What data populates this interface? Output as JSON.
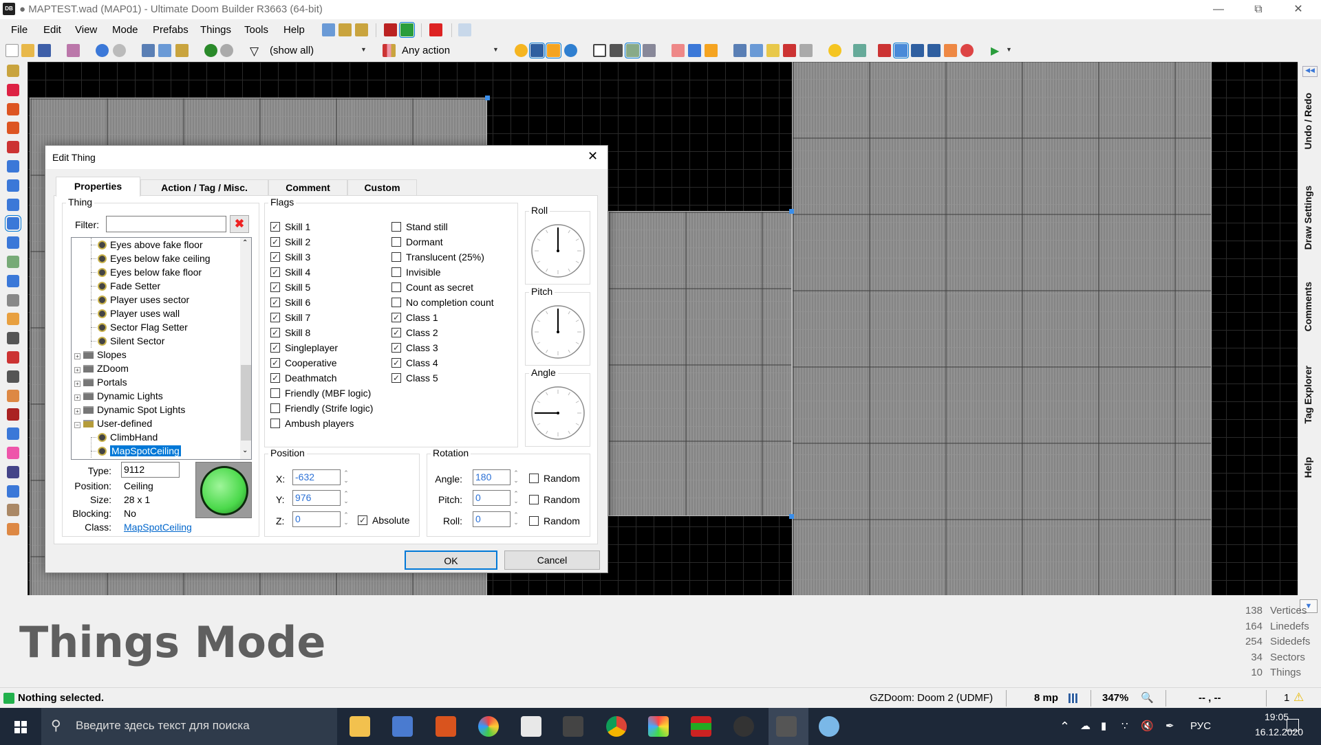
{
  "window": {
    "title": "● MAPTEST.wad (MAP01) - Ultimate Doom Builder R3663 (64-bit)",
    "logo": "DB"
  },
  "menu": [
    "File",
    "Edit",
    "View",
    "Mode",
    "Prefabs",
    "Things",
    "Tools",
    "Help"
  ],
  "toolbar": {
    "filter_value": "(show all)",
    "action_value": "Any action"
  },
  "side_tabs": [
    "Undo / Redo",
    "Draw Settings",
    "Comments",
    "Tag Explorer",
    "Help"
  ],
  "mode_title": "Things Mode",
  "stats": [
    {
      "count": "138",
      "label": "Vertices"
    },
    {
      "count": "164",
      "label": "Linedefs"
    },
    {
      "count": "254",
      "label": "Sidedefs"
    },
    {
      "count": "34",
      "label": "Sectors"
    },
    {
      "count": "10",
      "label": "Things"
    }
  ],
  "statusbar": {
    "message": "Nothing selected.",
    "game_config": "GZDoom: Doom 2 (UDMF)",
    "grid": "8 mp",
    "zoom": "347%",
    "coords": "-- , --",
    "warnings": "1",
    "status_color": "#22b14c"
  },
  "taskbar": {
    "search_placeholder": "Введите здесь текст для поиска",
    "language": "РУС",
    "time": "19:05",
    "date": "16.12.2020"
  },
  "dialog": {
    "title": "Edit Thing",
    "tabs": [
      "Properties",
      "Action / Tag / Misc.",
      "Comment",
      "Custom"
    ],
    "active_tab": 0,
    "thing_group": "Thing",
    "filter_label": "Filter:",
    "filter_value": "",
    "tree": [
      {
        "label": "Eyes above fake floor",
        "kind": "leaf"
      },
      {
        "label": "Eyes below fake ceiling",
        "kind": "leaf"
      },
      {
        "label": "Eyes below fake floor",
        "kind": "leaf"
      },
      {
        "label": "Fade Setter",
        "kind": "leaf"
      },
      {
        "label": "Player uses sector",
        "kind": "leaf"
      },
      {
        "label": "Player uses wall",
        "kind": "leaf"
      },
      {
        "label": "Sector Flag Setter",
        "kind": "leaf"
      },
      {
        "label": "Silent Sector",
        "kind": "leaf"
      },
      {
        "label": "Slopes",
        "kind": "folder"
      },
      {
        "label": "ZDoom",
        "kind": "folder"
      },
      {
        "label": "Portals",
        "kind": "folder"
      },
      {
        "label": "Dynamic Lights",
        "kind": "folder"
      },
      {
        "label": "Dynamic Spot Lights",
        "kind": "folder"
      },
      {
        "label": "User-defined",
        "kind": "folder-open"
      },
      {
        "label": "ClimbHand",
        "kind": "leaf"
      },
      {
        "label": "MapSpotCeiling",
        "kind": "leaf",
        "selected": true
      }
    ],
    "info": {
      "type_label": "Type:",
      "type_value": "9112",
      "position_label": "Position:",
      "position_value": "Ceiling",
      "size_label": "Size:",
      "size_value": "28 x 1",
      "blocking_label": "Blocking:",
      "blocking_value": "No",
      "class_label": "Class:",
      "class_value": "MapSpotCeiling"
    },
    "flags_group": "Flags",
    "flags_left": [
      {
        "label": "Skill 1",
        "checked": true
      },
      {
        "label": "Skill 2",
        "checked": true
      },
      {
        "label": "Skill 3",
        "checked": true
      },
      {
        "label": "Skill 4",
        "checked": true
      },
      {
        "label": "Skill 5",
        "checked": true
      },
      {
        "label": "Skill 6",
        "checked": true
      },
      {
        "label": "Skill 7",
        "checked": true
      },
      {
        "label": "Skill 8",
        "checked": true
      },
      {
        "label": "Singleplayer",
        "checked": true
      },
      {
        "label": "Cooperative",
        "checked": true
      },
      {
        "label": "Deathmatch",
        "checked": true
      },
      {
        "label": "Friendly (MBF logic)",
        "checked": false
      },
      {
        "label": "Friendly (Strife logic)",
        "checked": false
      },
      {
        "label": "Ambush players",
        "checked": false
      }
    ],
    "flags_right": [
      {
        "label": "Stand still",
        "checked": false
      },
      {
        "label": "Dormant",
        "checked": false
      },
      {
        "label": "Translucent (25%)",
        "checked": false
      },
      {
        "label": "Invisible",
        "checked": false
      },
      {
        "label": "Count as secret",
        "checked": false
      },
      {
        "label": "No completion count",
        "checked": false
      },
      {
        "label": "Class 1",
        "checked": true
      },
      {
        "label": "Class 2",
        "checked": true
      },
      {
        "label": "Class 3",
        "checked": true
      },
      {
        "label": "Class 4",
        "checked": true
      },
      {
        "label": "Class 5",
        "checked": true
      }
    ],
    "dials": [
      {
        "label": "Roll",
        "value": 0
      },
      {
        "label": "Pitch",
        "value": 0
      },
      {
        "label": "Angle",
        "value": 180
      }
    ],
    "position": {
      "group": "Position",
      "x_label": "X:",
      "x": "-632",
      "y_label": "Y:",
      "y": "976",
      "z_label": "Z:",
      "z": "0",
      "absolute_label": "Absolute",
      "absolute": true
    },
    "rotation": {
      "group": "Rotation",
      "angle_label": "Angle:",
      "angle": "180",
      "pitch_label": "Pitch:",
      "pitch": "0",
      "roll_label": "Roll:",
      "roll": "0",
      "random_label": "Random"
    },
    "ok": "OK",
    "cancel": "Cancel"
  }
}
